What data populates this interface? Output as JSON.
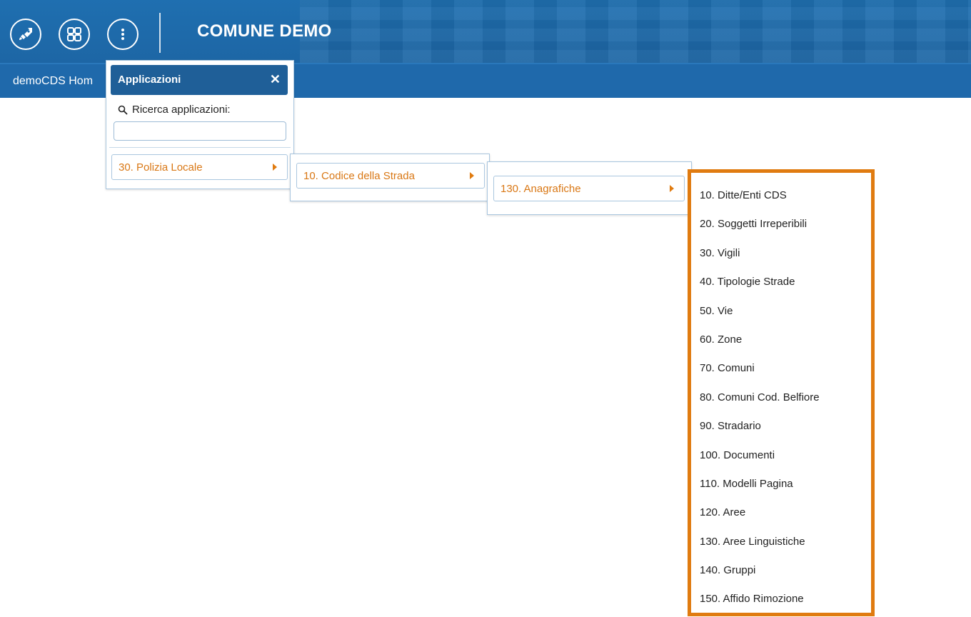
{
  "header": {
    "app_title": "COMUNE DEMO",
    "buttons": [
      {
        "name": "rocket-icon"
      },
      {
        "name": "grid-icon"
      },
      {
        "name": "more-vertical-icon"
      }
    ]
  },
  "breadcrumb": "demoCDS Hom",
  "applications_panel": {
    "title": "Applicazioni",
    "close_icon": "close-icon",
    "search_label": "Ricerca applicazioni:",
    "search_value": "",
    "item": "30. Polizia Locale"
  },
  "submenu_level2": {
    "item": "10. Codice della Strada"
  },
  "submenu_level3": {
    "item": "130. Anagrafiche"
  },
  "submenu_level4": {
    "items": [
      "10. Ditte/Enti CDS",
      "20. Soggetti Irreperibili",
      "30. Vigili",
      "40. Tipologie Strade",
      "50. Vie",
      "60. Zone",
      "70. Comuni",
      "80. Comuni Cod. Belfiore",
      "90. Stradario",
      "100. Documenti",
      "110. Modelli Pagina",
      "120. Aree",
      "130. Aree Linguistiche",
      "140. Gruppi",
      "150. Affido Rimozione"
    ]
  },
  "colors": {
    "header_blue": "#1f6fb0",
    "menu_text_orange": "#d97714",
    "highlight_border": "#e07b10"
  }
}
